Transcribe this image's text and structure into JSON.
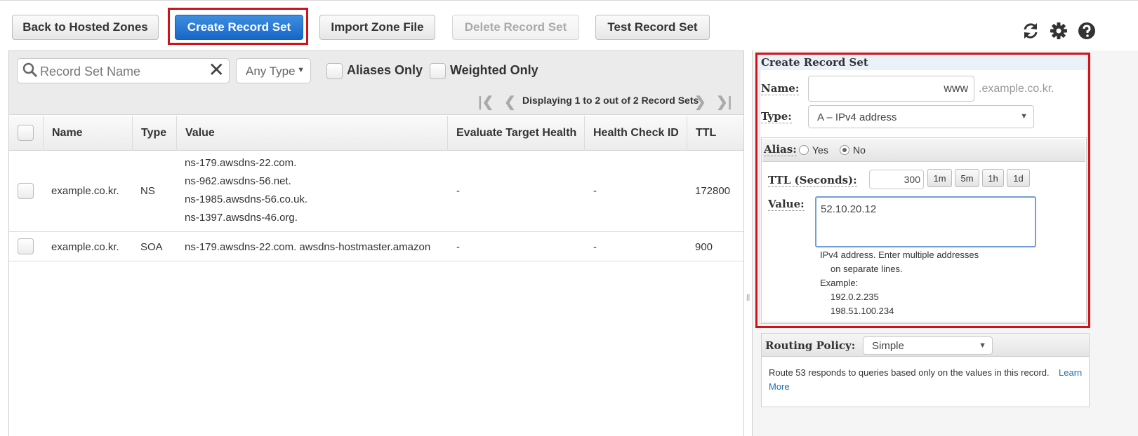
{
  "toolbar": {
    "back": "Back to Hosted Zones",
    "create": "Create Record Set",
    "import": "Import Zone File",
    "delete": "Delete Record Set",
    "test": "Test Record Set"
  },
  "filters": {
    "search_placeholder": "Record Set Name",
    "type": "Any Type",
    "aliases_only": "Aliases Only",
    "weighted_only": "Weighted Only",
    "pager_text": "Displaying 1 to 2 out of 2 Record Sets"
  },
  "table": {
    "headers": [
      "Name",
      "Type",
      "Value",
      "Evaluate Target Health",
      "Health Check ID",
      "TTL"
    ],
    "rows": [
      {
        "name": "example.co.kr.",
        "type": "NS",
        "values": [
          "ns-179.awsdns-22.com.",
          "ns-962.awsdns-56.net.",
          "ns-1985.awsdns-56.co.uk.",
          "ns-1397.awsdns-46.org."
        ],
        "eval": "-",
        "health": "-",
        "ttl": "172800"
      },
      {
        "name": "example.co.kr.",
        "type": "SOA",
        "values": [
          "ns-179.awsdns-22.com. awsdns-hostmaster.amazon"
        ],
        "eval": "-",
        "health": "-",
        "ttl": "900"
      }
    ]
  },
  "form": {
    "title": "Create Record Set",
    "name_label": "Name:",
    "name_value": "www",
    "domain_suffix": ".example.co.kr.",
    "type_label": "Type:",
    "type_value": "A – IPv4 address",
    "alias_label": "Alias:",
    "alias_yes": "Yes",
    "alias_no": "No",
    "ttl_label": "TTL (Seconds):",
    "ttl_value": "300",
    "ttl_presets": [
      "1m",
      "5m",
      "1h",
      "1d"
    ],
    "value_label": "Value:",
    "value_text": "52.10.20.12",
    "help_lines": [
      "IPv4 address. Enter multiple addresses",
      "on separate lines.",
      "Example:",
      "192.0.2.235",
      "198.51.100.234"
    ],
    "routing_label": "Routing Policy:",
    "routing_value": "Simple",
    "routing_desc": "Route 53 responds to queries based only on the values in this record.",
    "learn": "Learn",
    "more": "More"
  },
  "colors": {
    "primary_button": "#1766c8",
    "highlight_box": "#d0121a",
    "link": "#1e6fb3"
  },
  "icons": [
    "refresh-icon",
    "gear-icon",
    "help-icon",
    "search-icon",
    "clear-icon"
  ]
}
